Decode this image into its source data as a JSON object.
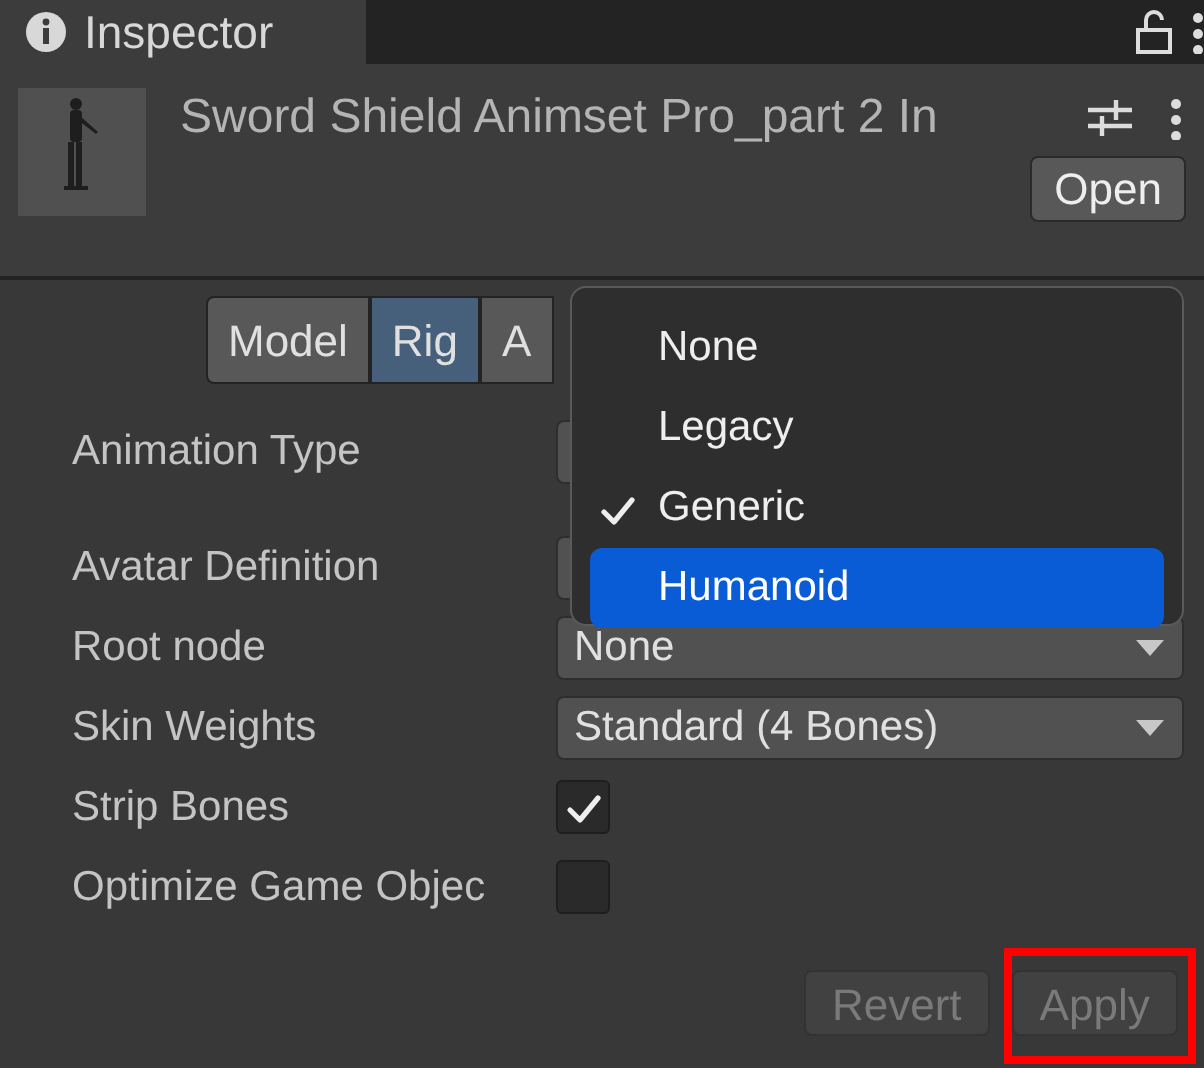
{
  "tab": {
    "title": "Inspector"
  },
  "asset": {
    "name": "Sword Shield Animset Pro_part 2 In",
    "open_button": "Open"
  },
  "mode_tabs": [
    {
      "label": "Model",
      "selected": false
    },
    {
      "label": "Rig",
      "selected": true
    },
    {
      "label": "A",
      "selected": false
    }
  ],
  "fields": [
    {
      "kind": "dropdown",
      "label": "Animation Type"
    },
    {
      "kind": "dropdown",
      "label": "Avatar Definition"
    },
    {
      "kind": "dropdown",
      "label": "Root node",
      "value": "None"
    },
    {
      "kind": "dropdown",
      "label": "Skin Weights",
      "value": "Standard (4 Bones)"
    },
    {
      "kind": "checkbox",
      "label": "Strip Bones",
      "checked": true
    },
    {
      "kind": "checkbox",
      "label": "Optimize Game Objec",
      "checked": false
    }
  ],
  "dropdown_menu": [
    {
      "label": "None",
      "checked": false,
      "highlighted": false
    },
    {
      "label": "Legacy",
      "checked": false,
      "highlighted": false
    },
    {
      "label": "Generic",
      "checked": true,
      "highlighted": false
    },
    {
      "label": "Humanoid",
      "checked": false,
      "highlighted": true
    }
  ],
  "buttons": [
    {
      "label": "Revert",
      "disabled": true,
      "framed": false
    },
    {
      "label": "Apply",
      "disabled": true,
      "framed": true
    }
  ]
}
